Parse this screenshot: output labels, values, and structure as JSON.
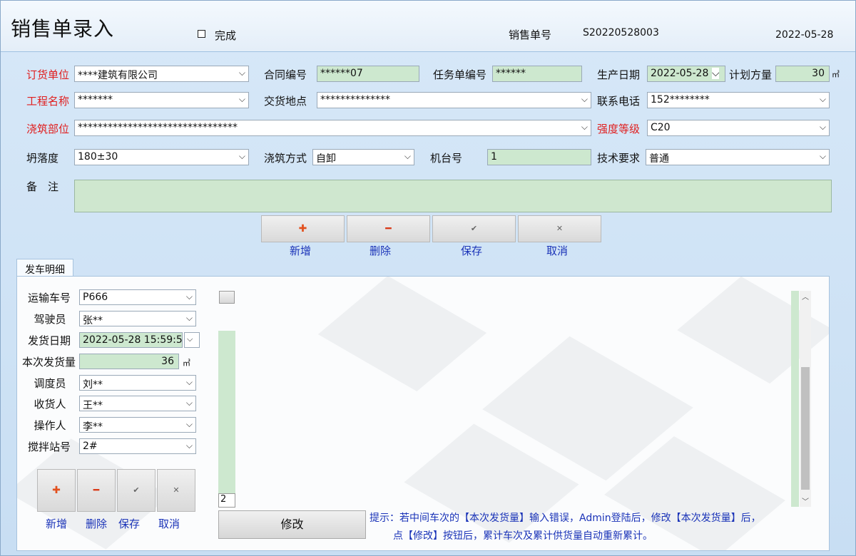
{
  "header": {
    "title": "销售单录入",
    "done_label": "完成",
    "order_label": "销售单号",
    "order_no": "S20220528003",
    "date": "2022-05-28"
  },
  "form": {
    "buyer": {
      "label": "订货单位",
      "value": "****建筑有限公司"
    },
    "contract": {
      "label": "合同编号",
      "value": "******07"
    },
    "task": {
      "label": "任务单编号",
      "value": "******"
    },
    "prod_date": {
      "label": "生产日期",
      "value": "2022-05-28"
    },
    "plan_vol": {
      "label": "计划方量",
      "value": "30",
      "unit": "㎥"
    },
    "project": {
      "label": "工程名称",
      "value": "*******"
    },
    "delivery": {
      "label": "交货地点",
      "value": "**************"
    },
    "phone": {
      "label": "联系电话",
      "value": "152********"
    },
    "pour_part": {
      "label": "浇筑部位",
      "value": "********************************"
    },
    "strength": {
      "label": "强度等级",
      "value": "C20"
    },
    "slump": {
      "label": "坍落度",
      "value": "180±30"
    },
    "pour_method": {
      "label": "浇筑方式",
      "value": "自卸"
    },
    "machine": {
      "label": "机台号",
      "value": "1"
    },
    "tech": {
      "label": "技术要求",
      "value": "普通"
    },
    "remark": {
      "label": "备　注",
      "value": ""
    }
  },
  "actions": {
    "add": "新增",
    "delete": "删除",
    "save": "保存",
    "cancel": "取消"
  },
  "tab": {
    "label": "发车明细"
  },
  "detail": {
    "truck": {
      "label": "运输车号",
      "value": "P666"
    },
    "driver": {
      "label": "驾驶员",
      "value": "张**"
    },
    "ship_date": {
      "label": "发货日期",
      "value": "2022-05-28 15:59:5"
    },
    "ship_qty": {
      "label": "本次发货量",
      "value": "36",
      "unit": "㎥"
    },
    "dispatcher": {
      "label": "调度员",
      "value": "刘**"
    },
    "receiver": {
      "label": "收货人",
      "value": "王**"
    },
    "operator": {
      "label": "操作人",
      "value": "李**"
    },
    "station": {
      "label": "搅拌站号",
      "value": "2#"
    }
  },
  "trip_count": "2",
  "modify_label": "修改",
  "hint": {
    "line1": "提示：若中间车次的【本次发货量】输入错误，Admin登陆后，修改【本次发货量】后，",
    "line2": "点【修改】按钮后，累计车次及累计供货量自动重新累计。"
  },
  "icons": {
    "dropdown": "chevron-down-icon",
    "add": "plus-icon",
    "delete": "minus-icon",
    "save": "check-icon",
    "cancel": "close-icon"
  },
  "colors": {
    "required_label": "#e02020",
    "readonly_field": "#cde8cf",
    "hint_text": "#1a33b8"
  }
}
